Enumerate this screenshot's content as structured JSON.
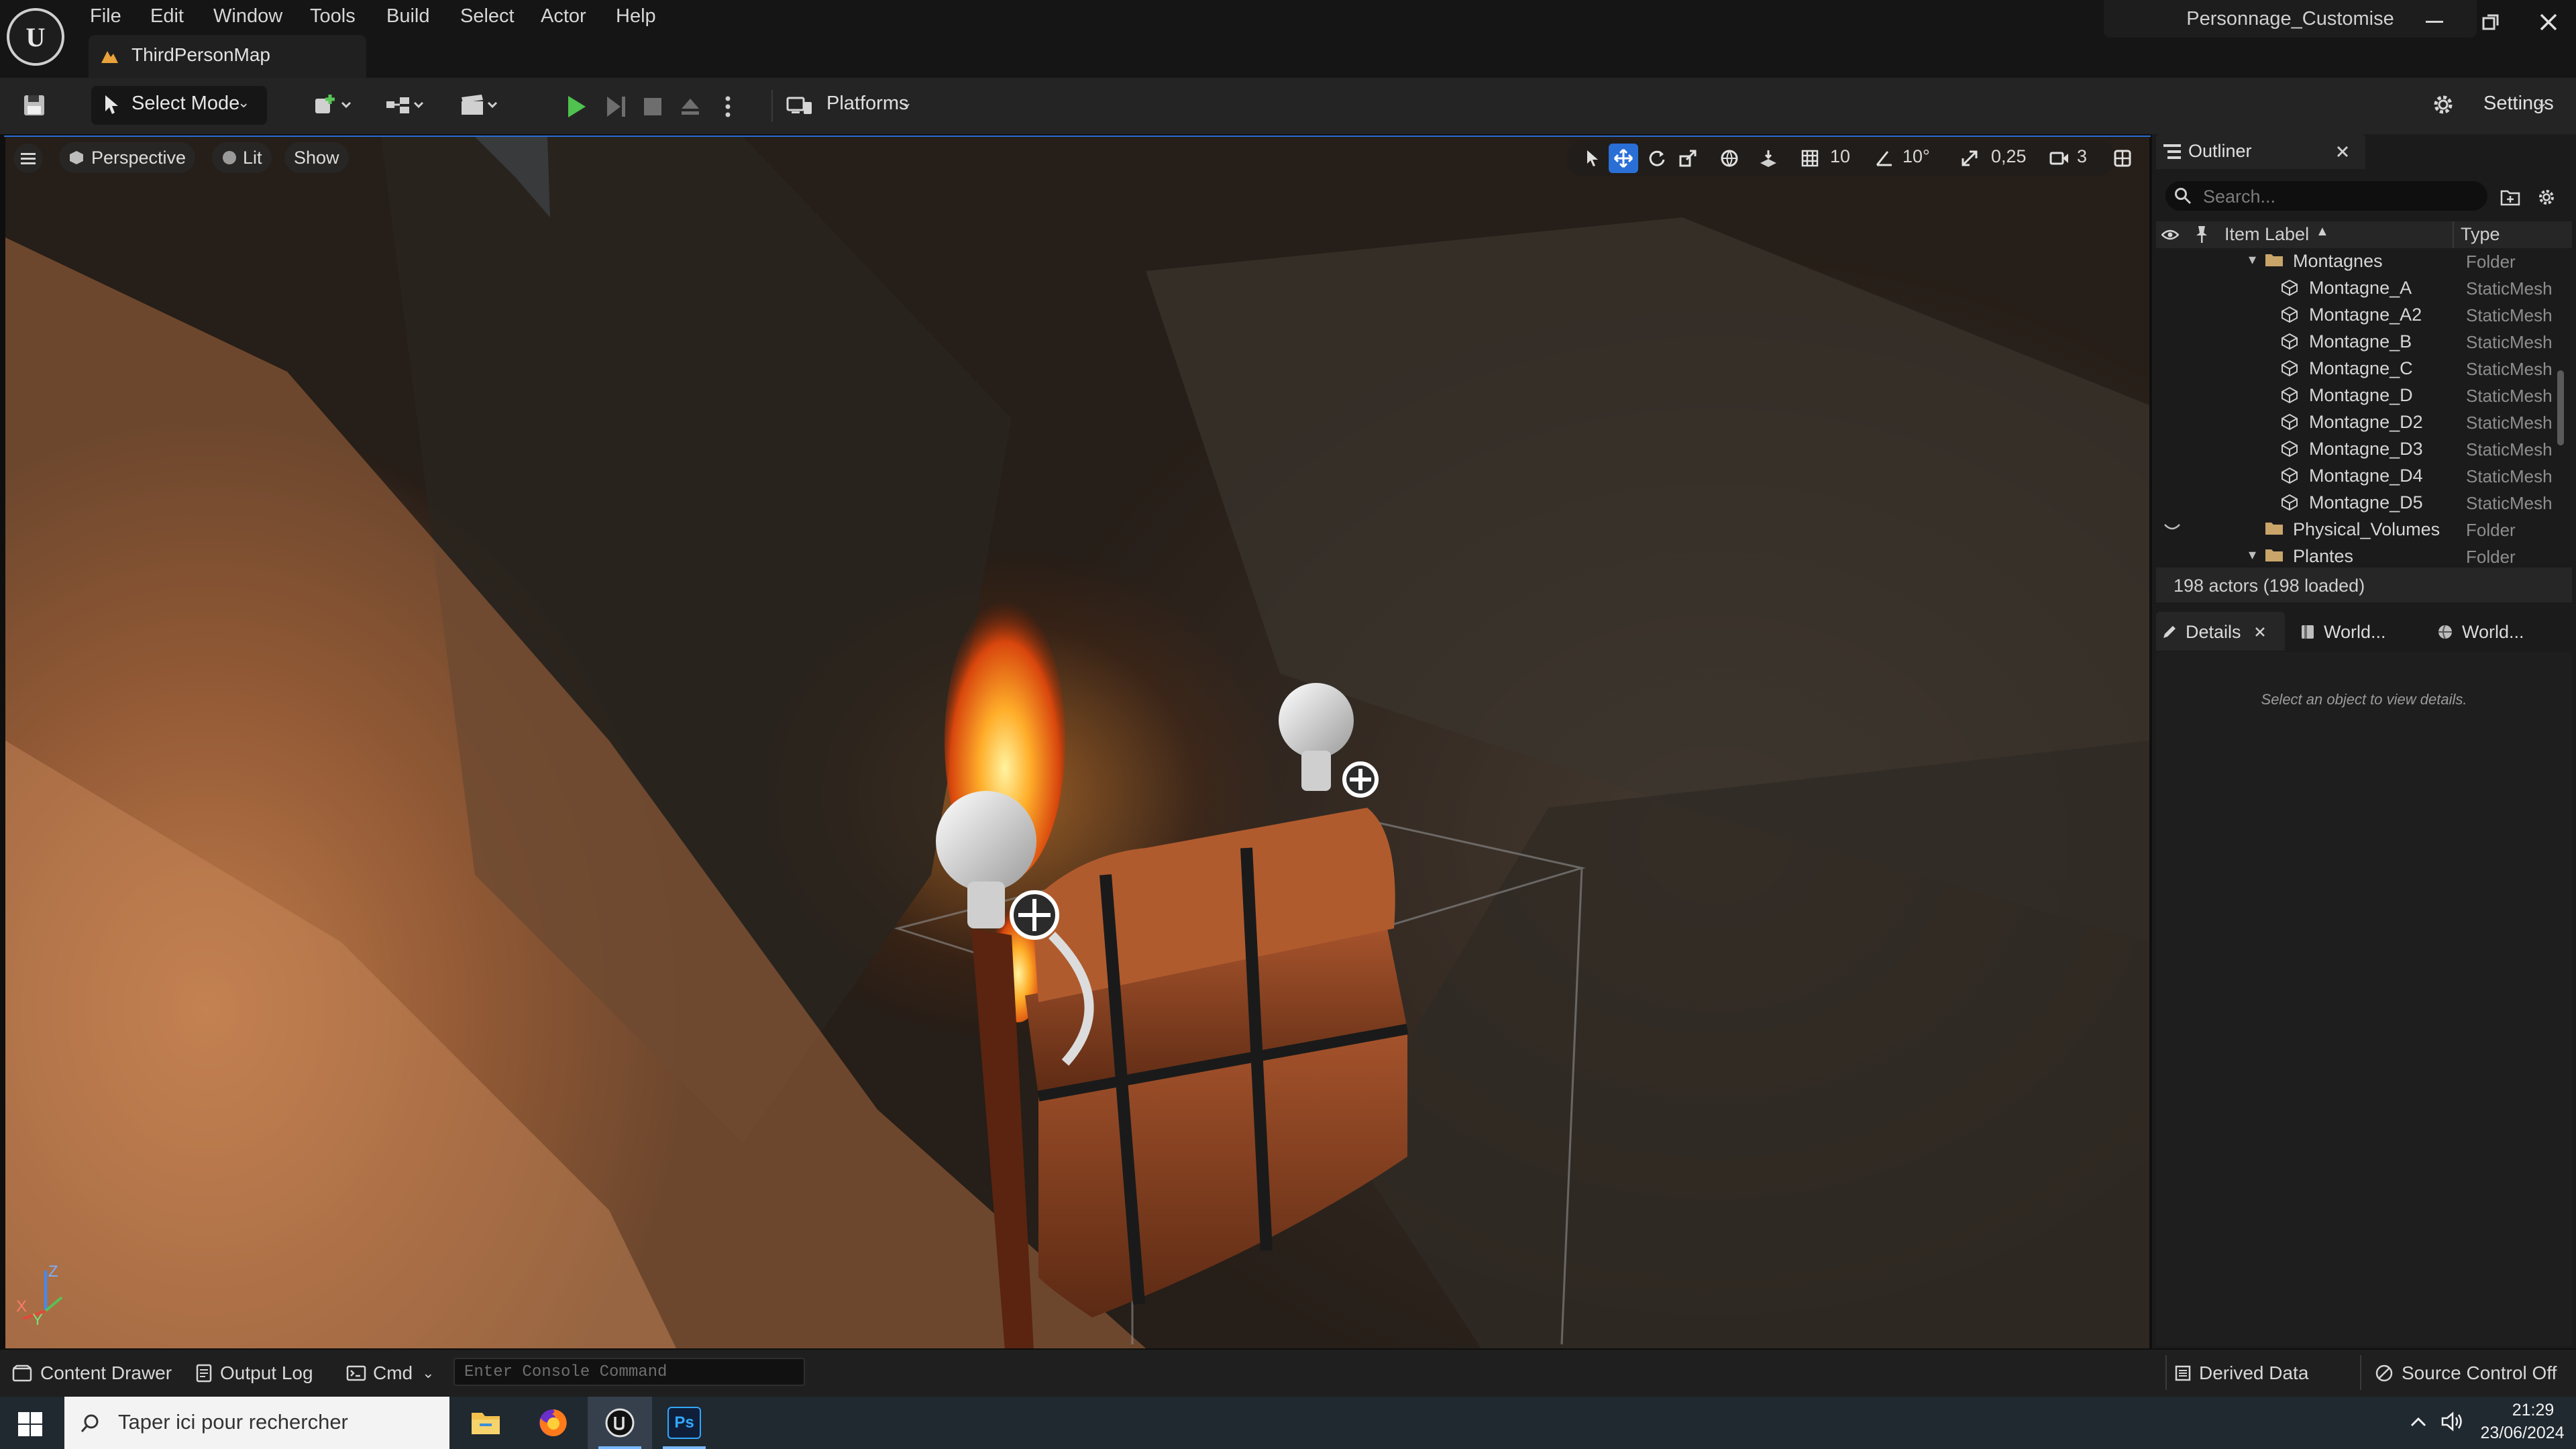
{
  "app": {
    "menu": [
      "File",
      "Edit",
      "Window",
      "Tools",
      "Build",
      "Select",
      "Actor",
      "Help"
    ],
    "document_tab": "ThirdPersonMap",
    "project_name": "Personnage_Customise"
  },
  "toolbar": {
    "select_mode": "Select Mode",
    "platforms": "Platforms",
    "settings": "Settings"
  },
  "viewport": {
    "view_mode": "Perspective",
    "lighting": "Lit",
    "show": "Show",
    "grid_snap": "10",
    "rotation_snap": "10°",
    "scale_snap": "0,25",
    "camera_speed": "3",
    "axis_labels": {
      "z": "Z",
      "x": "X",
      "y": "Y"
    }
  },
  "outliner": {
    "title": "Outliner",
    "search_placeholder": "Search...",
    "col_label": "Item Label",
    "col_type": "Type",
    "rows": [
      {
        "label": "Montagnes",
        "type": "Folder",
        "kind": "folder"
      },
      {
        "label": "Montagne_A",
        "type": "StaticMesh",
        "kind": "mesh"
      },
      {
        "label": "Montagne_A2",
        "type": "StaticMesh",
        "kind": "mesh"
      },
      {
        "label": "Montagne_B",
        "type": "StaticMesh",
        "kind": "mesh"
      },
      {
        "label": "Montagne_C",
        "type": "StaticMesh",
        "kind": "mesh"
      },
      {
        "label": "Montagne_D",
        "type": "StaticMesh",
        "kind": "mesh"
      },
      {
        "label": "Montagne_D2",
        "type": "StaticMesh",
        "kind": "mesh"
      },
      {
        "label": "Montagne_D3",
        "type": "StaticMesh",
        "kind": "mesh"
      },
      {
        "label": "Montagne_D4",
        "type": "StaticMesh",
        "kind": "mesh"
      },
      {
        "label": "Montagne_D5",
        "type": "StaticMesh",
        "kind": "mesh"
      },
      {
        "label": "Physical_Volumes",
        "type": "Folder",
        "kind": "folder"
      },
      {
        "label": "Plantes",
        "type": "Folder",
        "kind": "folder"
      }
    ],
    "actor_count": "198 actors (198 loaded)"
  },
  "details": {
    "tabs": [
      "Details",
      "World...",
      "World..."
    ],
    "empty_message": "Select an object to view details."
  },
  "bottom_bar": {
    "content_drawer": "Content Drawer",
    "output_log": "Output Log",
    "cmd": "Cmd",
    "console_placeholder": "Enter Console Command",
    "derived_data": "Derived Data",
    "source_control": "Source Control Off"
  },
  "taskbar": {
    "search_placeholder": "Taper ici pour rechercher",
    "time": "21:29",
    "date": "23/06/2024",
    "photoshop_label": "Ps"
  },
  "colors": {
    "accent_blue": "#2a6fd6",
    "play_green": "#4fc24f",
    "folder": "#c9a56a"
  }
}
